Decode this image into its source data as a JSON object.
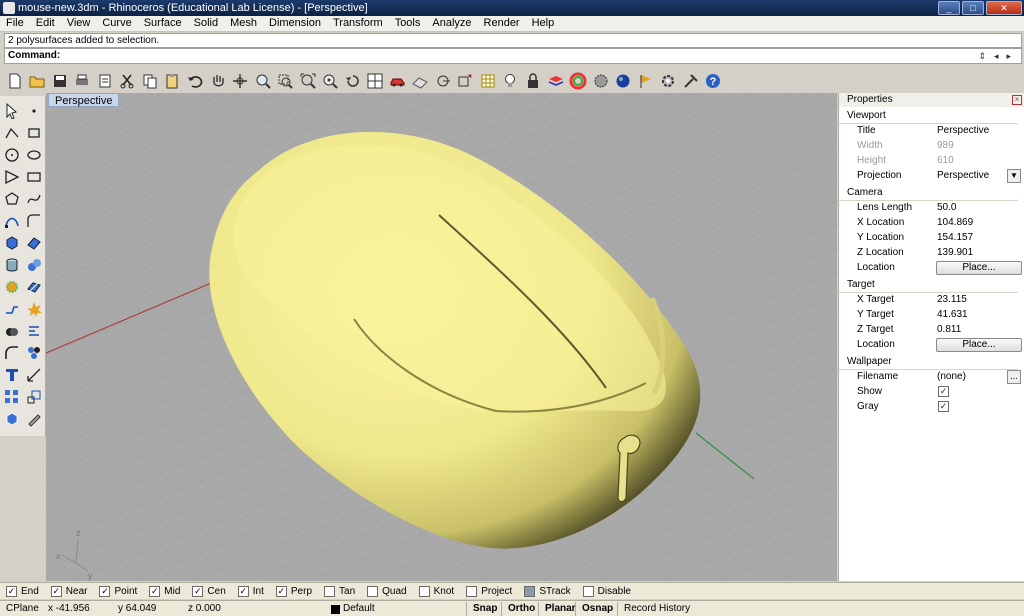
{
  "window": {
    "title": "mouse-new.3dm - Rhinoceros (Educational Lab License) - [Perspective]"
  },
  "menu": [
    "File",
    "Edit",
    "View",
    "Curve",
    "Surface",
    "Solid",
    "Mesh",
    "Dimension",
    "Transform",
    "Tools",
    "Analyze",
    "Render",
    "Help"
  ],
  "command_history": "2 polysurfaces added to selection.",
  "command_prompt": "Command:",
  "viewport": {
    "label": "Perspective",
    "background": "#a9a9a9",
    "model_color": "#f4ee8c"
  },
  "properties": {
    "title": "Properties",
    "sections": {
      "viewport": "Viewport",
      "camera": "Camera",
      "target": "Target",
      "wallpaper": "Wallpaper"
    },
    "viewport_rows": {
      "title_k": "Title",
      "title_v": "Perspective",
      "width_k": "Width",
      "width_v": "989",
      "height_k": "Height",
      "height_v": "610",
      "projection_k": "Projection",
      "projection_v": "Perspective"
    },
    "camera_rows": {
      "lens_k": "Lens Length",
      "lens_v": "50.0",
      "xloc_k": "X Location",
      "xloc_v": "104.869",
      "yloc_k": "Y Location",
      "yloc_v": "154.157",
      "zloc_k": "Z Location",
      "zloc_v": "139.901",
      "loc_k": "Location",
      "loc_btn": "Place..."
    },
    "target_rows": {
      "xt_k": "X Target",
      "xt_v": "23.115",
      "yt_k": "Y Target",
      "yt_v": "41.631",
      "zt_k": "Z Target",
      "zt_v": "0.811",
      "loc_k": "Location",
      "loc_btn": "Place..."
    },
    "wallpaper_rows": {
      "file_k": "Filename",
      "file_v": "(none)",
      "show_k": "Show",
      "show_checked": true,
      "gray_k": "Gray",
      "gray_checked": true
    }
  },
  "osnaps": [
    {
      "label": "End",
      "checked": true
    },
    {
      "label": "Near",
      "checked": true
    },
    {
      "label": "Point",
      "checked": true
    },
    {
      "label": "Mid",
      "checked": true
    },
    {
      "label": "Cen",
      "checked": true
    },
    {
      "label": "Int",
      "checked": true
    },
    {
      "label": "Perp",
      "checked": true
    },
    {
      "label": "Tan",
      "checked": false
    },
    {
      "label": "Quad",
      "checked": false
    },
    {
      "label": "Knot",
      "checked": false
    },
    {
      "label": "Project",
      "checked": false
    },
    {
      "label": "STrack",
      "checked": false
    },
    {
      "label": "Disable",
      "checked": false
    }
  ],
  "status": {
    "cplane": "CPlane",
    "x": "x -41.956",
    "y": "y 64.049",
    "z": "z 0.000",
    "layer": "Default",
    "panes": [
      "Snap",
      "Ortho",
      "Planar",
      "Osnap",
      "Record History"
    ]
  },
  "axis_labels": {
    "x": "x",
    "y": "y",
    "z": "z"
  }
}
